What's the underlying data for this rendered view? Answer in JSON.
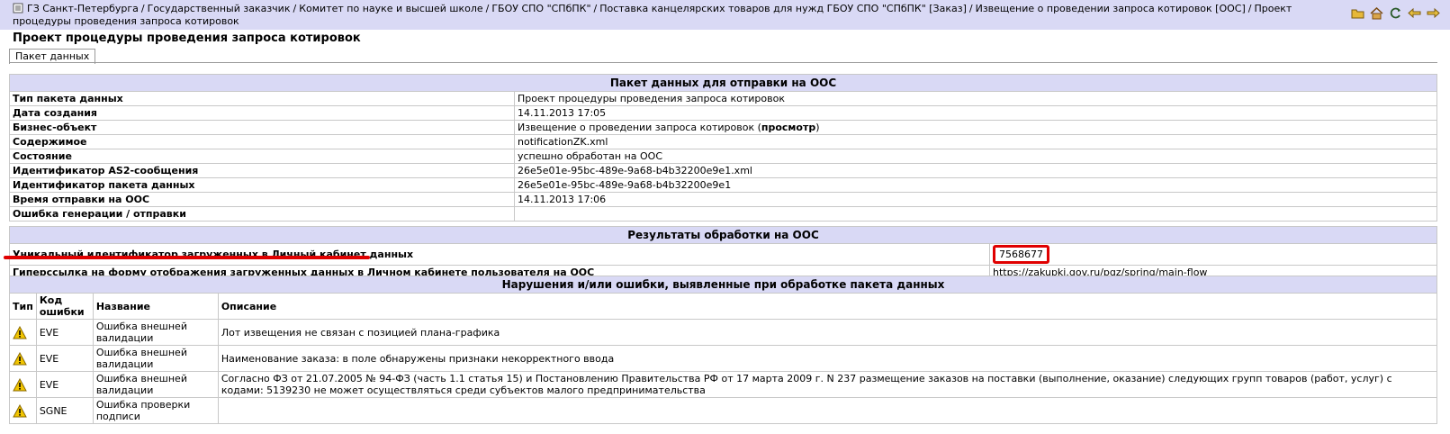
{
  "breadcrumb": [
    "ГЗ Санкт-Петербурга",
    "Государственный заказчик",
    "Комитет по науке и высшей школе",
    "ГБОУ СПО \"СПбПК\"",
    "Поставка канцелярских товаров для нужд ГБОУ СПО \"СПбПК\" [Заказ]",
    "Извещение о проведении запроса котировок [ООС]",
    "Проект процедуры проведения запроса котировок"
  ],
  "page_title": "Проект процедуры проведения запроса котировок",
  "tab_label": "Пакет данных",
  "section1": {
    "title": "Пакет данных для отправки на ООС",
    "rows": [
      {
        "label": "Тип пакета данных",
        "value": "Проект процедуры проведения запроса котировок"
      },
      {
        "label": "Дата создания",
        "value": "14.11.2013 17:05"
      },
      {
        "label": "Бизнес-объект",
        "value": "Извещение о проведении запроса котировок ("
      },
      {
        "label": "Содержимое",
        "value": "notificationZK.xml"
      },
      {
        "label": "Состояние",
        "value": "успешно обработан на ООС"
      },
      {
        "label": "Идентификатор AS2-сообщения",
        "value": "26e5e01e-95bc-489e-9a68-b4b32200e9e1.xml"
      },
      {
        "label": "Идентификатор пакета данных",
        "value": "26e5e01e-95bc-489e-9a68-b4b32200e9e1"
      },
      {
        "label": "Время отправки на ООС",
        "value": "14.11.2013 17:06"
      },
      {
        "label": "Ошибка генерации / отправки",
        "value": ""
      }
    ],
    "view_link": "просмотр",
    "view_close": ")"
  },
  "section2": {
    "title": "Результаты обработки на ООС",
    "uid_label": "Уникальный идентификатор загруженных в Личный кабинет данных",
    "uid_value": "7568677",
    "link_label": "Гиперссылка на форму отображения загруженных данных в Личном кабинете пользователя на ООС",
    "link_value": "https://zakupki.gov.ru/pgz/spring/main-flow"
  },
  "section3": {
    "title": "Нарушения и/или ошибки, выявленные при обработке пакета данных",
    "headers": {
      "type": "Тип",
      "code": "Код ошибки",
      "name": "Название",
      "desc": "Описание"
    },
    "rows": [
      {
        "code": "EVE",
        "name": "Ошибка внешней валидации",
        "desc": "Лот извещения не связан с позицией плана-графика"
      },
      {
        "code": "EVE",
        "name": "Ошибка внешней валидации",
        "desc": "Наименование заказа: в поле обнаружены признаки некорректного ввода"
      },
      {
        "code": "EVE",
        "name": "Ошибка внешней валидации",
        "desc": "Согласно ФЗ от 21.07.2005 № 94-ФЗ (часть 1.1 статья 15) и Постановлению Правительства РФ от 17 марта 2009 г. N 237 размещение заказов на поставки (выполнение, оказание) следующих групп товаров (работ, услуг) с кодами: 5139230 не может осуществляться среди субъектов малого предпринимательства"
      },
      {
        "code": "SGNE",
        "name": "Ошибка проверки подписи",
        "desc": ""
      }
    ]
  },
  "colors": {
    "header_bg": "#d9d9f5",
    "highlight": "#e00000",
    "warning": "#f2c500"
  }
}
